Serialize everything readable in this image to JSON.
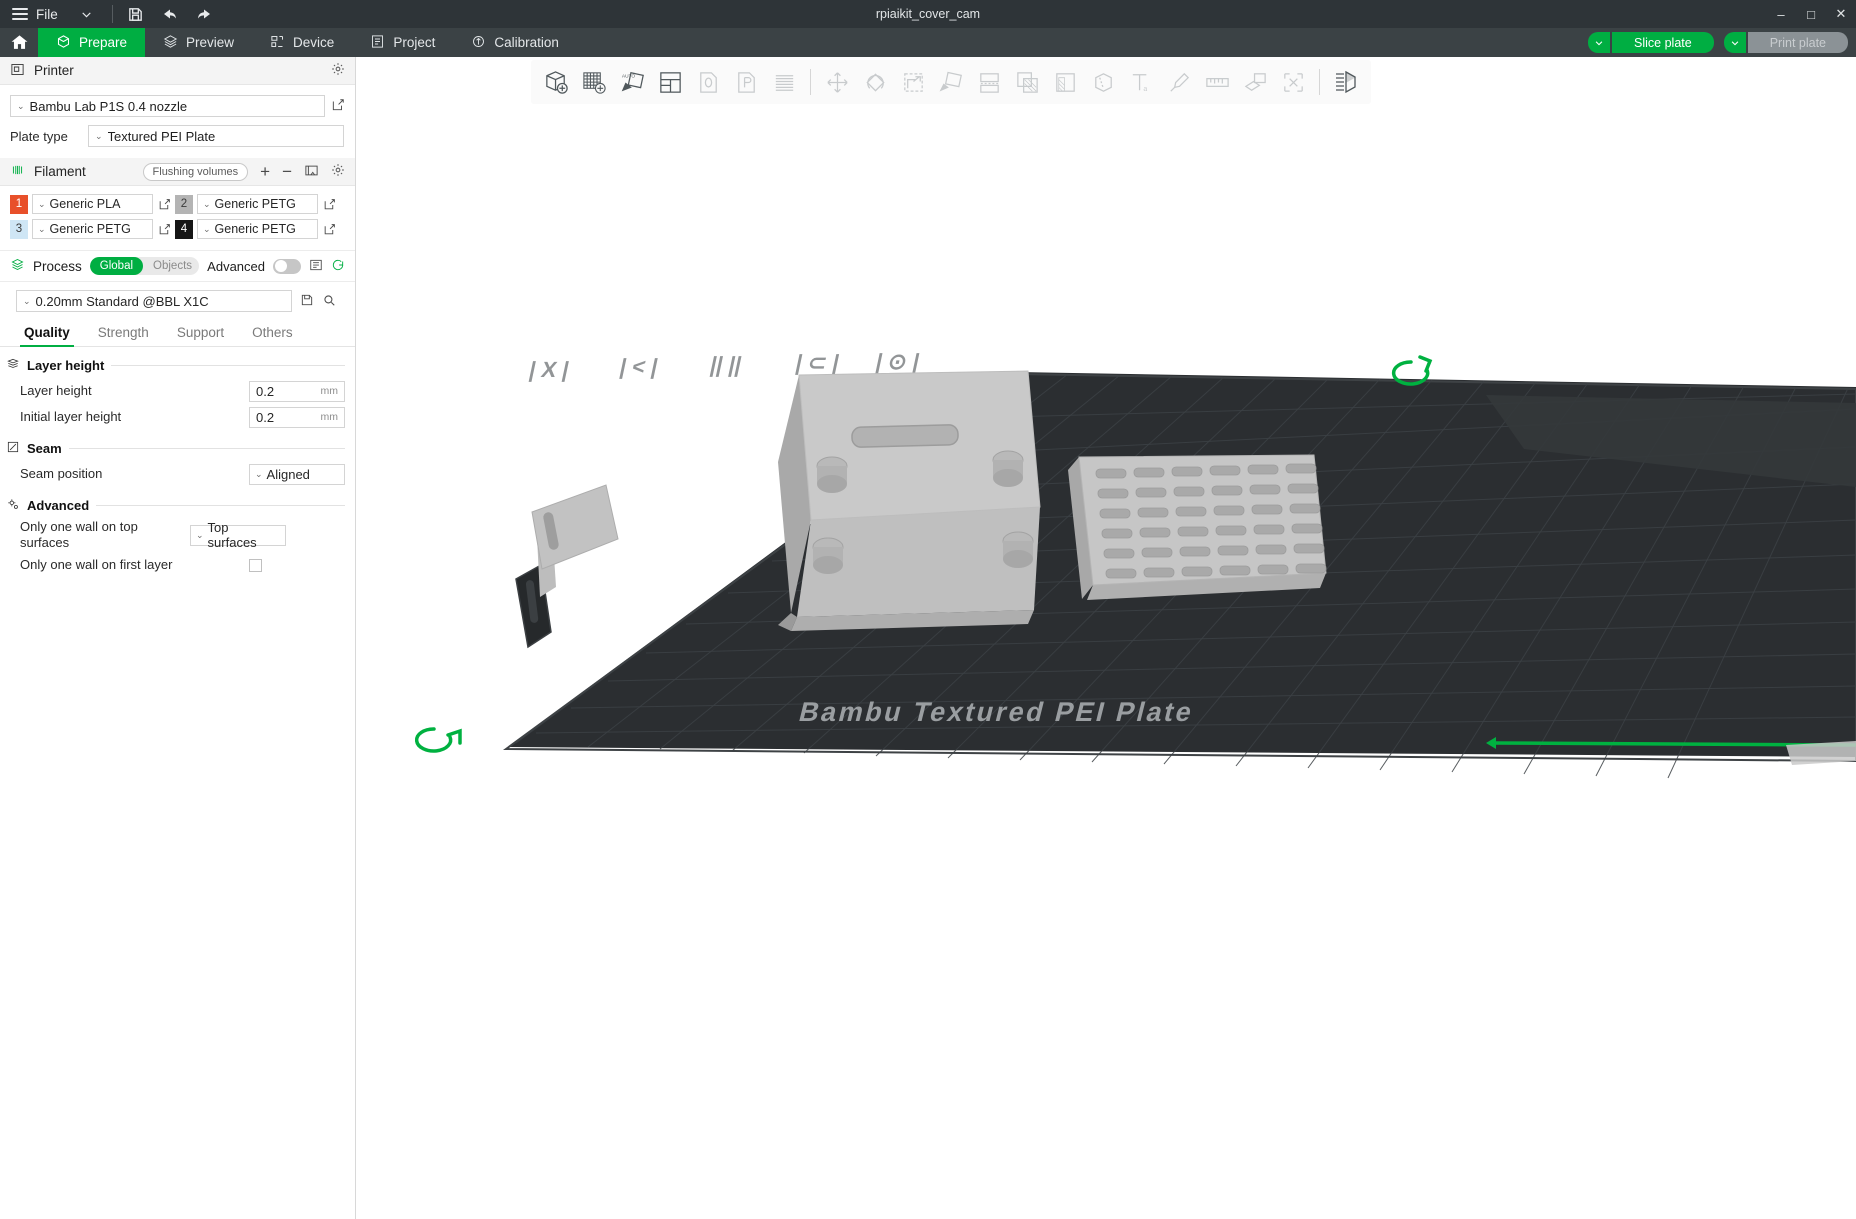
{
  "window": {
    "title": "rpiaikit_cover_cam",
    "controls": {
      "minimize": "–",
      "maximize": "□",
      "close": "✕"
    }
  },
  "titlebar": {
    "file_label": "File",
    "menu_icon": "hamburger-icon",
    "caret_icon": "chevron-down-icon",
    "save_icon": "save-icon",
    "undo_icon": "undo-arrow-icon",
    "redo_icon": "redo-arrow-icon"
  },
  "topnav": {
    "home_icon": "home-icon",
    "tabs": [
      {
        "label": "Prepare",
        "icon": "cube-outline-icon",
        "active": true
      },
      {
        "label": "Preview",
        "icon": "layers-icon",
        "active": false
      },
      {
        "label": "Device",
        "icon": "printer-device-icon",
        "active": false
      },
      {
        "label": "Project",
        "icon": "project-list-icon",
        "active": false
      },
      {
        "label": "Calibration",
        "icon": "calibration-target-icon",
        "active": false
      }
    ],
    "slice_button": {
      "label": "Slice plate",
      "caret": "chevron-down-icon",
      "enabled": true
    },
    "print_button": {
      "label": "Print plate",
      "caret": "chevron-down-icon",
      "enabled": false
    }
  },
  "sidebar": {
    "printer": {
      "header": "Printer",
      "header_icon": "printer-icon",
      "settings_icon": "gear-icon",
      "preset": "Bambu Lab P1S 0.4 nozzle",
      "edit_icon": "edit-square-icon",
      "plate_type_label": "Plate type",
      "plate_type_value": "Textured PEI Plate"
    },
    "filament": {
      "header": "Filament",
      "header_icon": "filament-spool-icon",
      "flushing_volumes_label": "Flushing volumes",
      "add_icon": "plus-icon",
      "remove_icon": "minus-icon",
      "sync_icon": "ams-sync-icon",
      "settings_icon": "gear-icon",
      "slots": [
        {
          "index": "1",
          "name": "Generic PLA",
          "color": "#e8502a",
          "text_color": "#ffffff",
          "edit_icon": "edit-square-icon"
        },
        {
          "index": "2",
          "name": "Generic PETG",
          "color": "#b4b4b4",
          "text_color": "#3a3a3a",
          "edit_icon": "edit-square-icon"
        },
        {
          "index": "3",
          "name": "Generic PETG",
          "color": "#cfe6f5",
          "text_color": "#3a3a3a",
          "edit_icon": "edit-square-icon"
        },
        {
          "index": "4",
          "name": "Generic PETG",
          "color": "#151515",
          "text_color": "#ffffff",
          "edit_icon": "edit-square-icon"
        }
      ]
    },
    "process": {
      "header": "Process",
      "header_icon": "process-stack-icon",
      "scope_global": "Global",
      "scope_objects": "Objects",
      "advanced_label": "Advanced",
      "advanced_on": false,
      "compare_icon": "compare-icon",
      "reset_icon": "reset-icon",
      "preset": "0.20mm Standard @BBL X1C",
      "save_icon": "save-preset-icon",
      "search_icon": "search-icon",
      "tabs": [
        {
          "label": "Quality",
          "active": true
        },
        {
          "label": "Strength",
          "active": false
        },
        {
          "label": "Support",
          "active": false
        },
        {
          "label": "Others",
          "active": false
        }
      ],
      "groups": [
        {
          "title": "Layer height",
          "icon": "layer-height-icon",
          "options": [
            {
              "label": "Layer height",
              "type": "number",
              "value": "0.2",
              "unit": "mm"
            },
            {
              "label": "Initial layer height",
              "type": "number",
              "value": "0.2",
              "unit": "mm"
            }
          ]
        },
        {
          "title": "Seam",
          "icon": "seam-icon",
          "options": [
            {
              "label": "Seam position",
              "type": "select",
              "value": "Aligned"
            }
          ]
        },
        {
          "title": "Advanced",
          "icon": "advanced-gear-icon",
          "options": [
            {
              "label": "Only one wall on top surfaces",
              "type": "select",
              "value": "Top surfaces"
            },
            {
              "label": "Only one wall on first layer",
              "type": "checkbox",
              "checked": false
            }
          ]
        }
      ]
    }
  },
  "viewport": {
    "toolbar": [
      {
        "name": "add-object-icon",
        "tip": "Add object"
      },
      {
        "name": "add-plate-icon",
        "tip": "Add plate"
      },
      {
        "name": "auto-arrange-icon",
        "tip": "Auto arrange"
      },
      {
        "name": "arrange-options-icon",
        "tip": "Arrange options"
      },
      {
        "name": "orient-0-icon",
        "tip": "Orient"
      },
      {
        "name": "orient-p-icon",
        "tip": "Orient P"
      },
      {
        "name": "split-layers-icon",
        "tip": "Split to parts"
      },
      {
        "name": "move-icon",
        "tip": "Move"
      },
      {
        "name": "rotate-icon",
        "tip": "Rotate"
      },
      {
        "name": "scale-icon",
        "tip": "Scale"
      },
      {
        "name": "place-on-face-icon",
        "tip": "Place on face"
      },
      {
        "name": "cut-icon",
        "tip": "Cut"
      },
      {
        "name": "support-paint-icon",
        "tip": "Support painting"
      },
      {
        "name": "color-paint-icon",
        "tip": "Color painting"
      },
      {
        "name": "seam-paint-icon",
        "tip": "Seam painting"
      },
      {
        "name": "text-emboss-icon",
        "tip": "Text shape"
      },
      {
        "name": "brush-icon",
        "tip": "Brush"
      },
      {
        "name": "measure-icon",
        "tip": "Measure"
      },
      {
        "name": "assembly-icon",
        "tip": "Assembly"
      },
      {
        "name": "simplify-icon",
        "tip": "Simplify model"
      },
      {
        "name": "variable-layer-icon",
        "tip": "Variable layer height"
      }
    ],
    "plate_label": "Bambu Textured PEI Plate",
    "plate_color": "#2a2d30",
    "model_color": "#b9b9b9",
    "accent_color": "#00b140"
  }
}
